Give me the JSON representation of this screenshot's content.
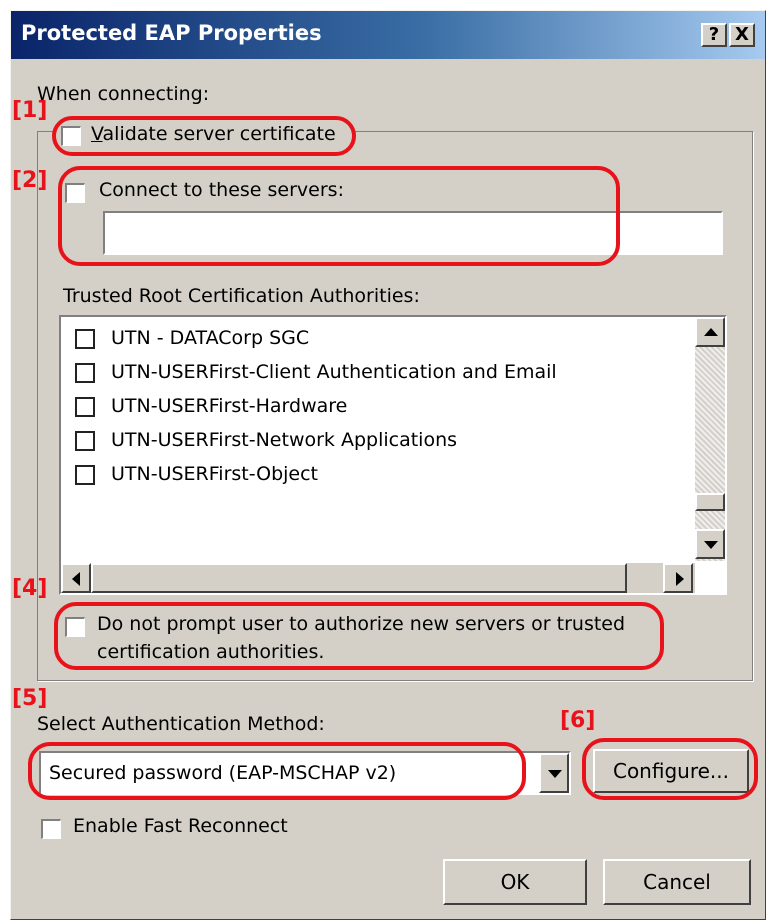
{
  "window": {
    "title": "Protected EAP Properties",
    "help_label": "?",
    "close_label": "X"
  },
  "when_connecting_label": "When connecting:",
  "validate_cert": {
    "label": "Validate server certificate",
    "checked": false
  },
  "connect_servers": {
    "label": "Connect to these servers:",
    "checked": false,
    "value": ""
  },
  "trusted_root_label": "Trusted Root Certification Authorities:",
  "ca_list": [
    {
      "label": "UTN - DATACorp SGC",
      "checked": false
    },
    {
      "label": "UTN-USERFirst-Client Authentication and Email",
      "checked": false
    },
    {
      "label": "UTN-USERFirst-Hardware",
      "checked": false
    },
    {
      "label": "UTN-USERFirst-Network Applications",
      "checked": false
    },
    {
      "label": "UTN-USERFirst-Object",
      "checked": false
    }
  ],
  "no_prompt": {
    "line1": "Do not prompt user to authorize new servers or trusted",
    "line2": "certification authorities.",
    "checked": false
  },
  "auth_method": {
    "label": "Select Authentication Method:",
    "selected": "Secured password (EAP-MSCHAP v2)",
    "configure_label": "Configure..."
  },
  "fast_reconnect": {
    "label": "Enable Fast Reconnect",
    "checked": false
  },
  "buttons": {
    "ok": "OK",
    "cancel": "Cancel"
  },
  "annotations": {
    "tag1": "[1]",
    "tag2": "[2]",
    "tag4": "[4]",
    "tag5": "[5]",
    "tag6": "[6]",
    "color": "#e8121b"
  },
  "colors": {
    "dialog_bg": "#d4d0c8",
    "title_start": "#0a246a",
    "title_end": "#a6caf0"
  }
}
